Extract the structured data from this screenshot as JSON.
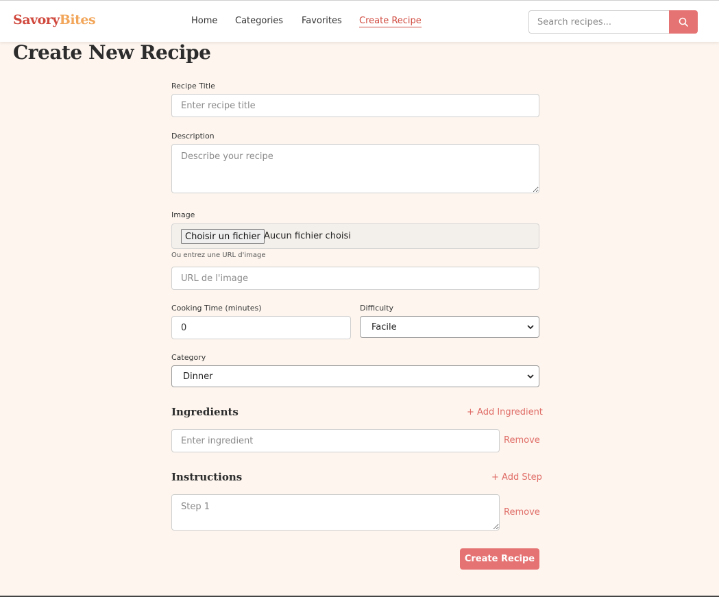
{
  "header": {
    "logo_part1": "Savory",
    "logo_part2": "Bites",
    "nav": [
      "Home",
      "Categories",
      "Favorites",
      "Create Recipe"
    ],
    "active_nav": "Create Recipe",
    "search_placeholder": "Search recipes...",
    "search_icon": "search-icon"
  },
  "page": {
    "title": "Create New Recipe"
  },
  "form": {
    "title_label": "Recipe Title",
    "title_placeholder": "Enter recipe title",
    "description_label": "Description",
    "description_placeholder": "Describe your recipe",
    "image_label": "Image",
    "file_button": "Choisir un fichier",
    "file_status": "Aucun fichier choisi",
    "image_url_hint": "Ou entrez une URL d'image",
    "image_url_placeholder": "URL de l'image",
    "cooking_time_label": "Cooking Time (minutes)",
    "cooking_time_value": "0",
    "difficulty_label": "Difficulty",
    "difficulty_value": "Facile",
    "category_label": "Category",
    "category_value": "Dinner",
    "ingredients_title": "Ingredients",
    "add_ingredient": "+ Add Ingredient",
    "ingredient_placeholder": "Enter ingredient",
    "remove_label": "Remove",
    "instructions_title": "Instructions",
    "add_step": "+ Add Step",
    "step_placeholder": "Step 1",
    "submit_label": "Create Recipe"
  },
  "colors": {
    "accent": "#e57373",
    "logo_red": "#d0493e",
    "logo_orange": "#f2a65a",
    "background": "#fdf5ee"
  }
}
